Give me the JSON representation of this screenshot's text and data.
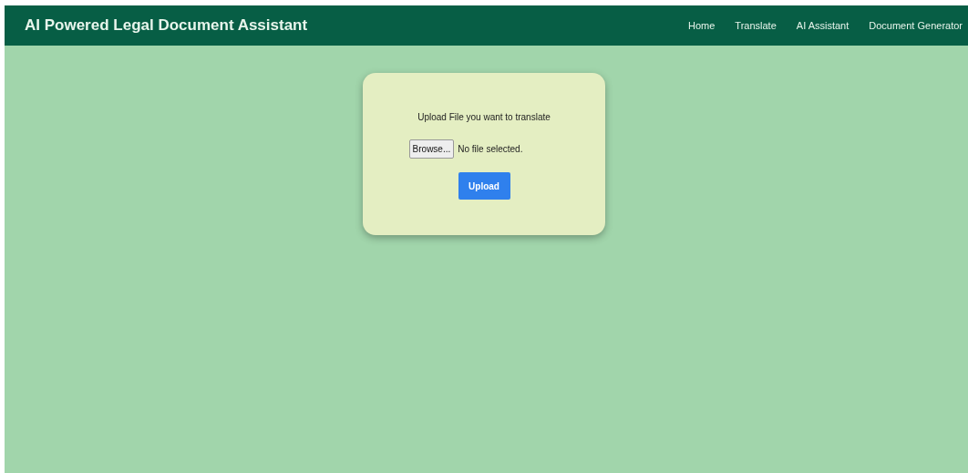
{
  "header": {
    "title": "AI Powered Legal Document Assistant",
    "nav": [
      {
        "label": "Home"
      },
      {
        "label": "Translate"
      },
      {
        "label": "AI Assistant"
      },
      {
        "label": "Document Generator"
      }
    ]
  },
  "upload_card": {
    "prompt": "Upload File you want to translate",
    "browse_button": "Browse...",
    "file_status": "No file selected.",
    "upload_button": "Upload"
  }
}
